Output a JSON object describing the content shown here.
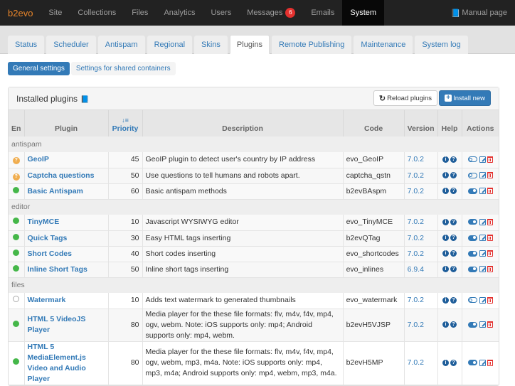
{
  "topnav": {
    "brand": "b2evo",
    "items": [
      {
        "label": "Site"
      },
      {
        "label": "Collections"
      },
      {
        "label": "Files"
      },
      {
        "label": "Analytics"
      },
      {
        "label": "Users"
      },
      {
        "label": "Messages",
        "badge": "6"
      },
      {
        "label": "Emails"
      },
      {
        "label": "System",
        "active": true
      }
    ],
    "manual_label": "Manual page",
    "manual_icon": "book-icon"
  },
  "tabs": [
    {
      "label": "Status"
    },
    {
      "label": "Scheduler"
    },
    {
      "label": "Antispam"
    },
    {
      "label": "Regional"
    },
    {
      "label": "Skins"
    },
    {
      "label": "Plugins",
      "active": true
    },
    {
      "label": "Remote Publishing"
    },
    {
      "label": "Maintenance"
    },
    {
      "label": "System log"
    }
  ],
  "subtabs": [
    {
      "label": "General settings",
      "active": true
    },
    {
      "label": "Settings for shared containers"
    }
  ],
  "panel": {
    "title": "Installed plugins",
    "title_icon": "book-icon",
    "reload_label": "Reload plugins",
    "install_label": "Install new"
  },
  "table": {
    "columns": {
      "en": "En",
      "plugin": "Plugin",
      "priority": "Priority",
      "description": "Description",
      "code": "Code",
      "version": "Version",
      "help": "Help",
      "actions": "Actions"
    },
    "groups": [
      {
        "name": "antispam",
        "rows": [
          {
            "status": "warn",
            "plugin": "GeoIP",
            "priority": "45",
            "description": "GeoIP plugin to detect user's country by IP address",
            "code": "evo_GeoIP",
            "version": "7.0.2",
            "enabled": false
          },
          {
            "status": "warn",
            "plugin": "Captcha questions",
            "priority": "50",
            "description": "Use questions to tell humans and robots apart.",
            "code": "captcha_qstn",
            "version": "7.0.2",
            "enabled": false
          },
          {
            "status": "on",
            "plugin": "Basic Antispam",
            "priority": "60",
            "description": "Basic antispam methods",
            "code": "b2evBAspm",
            "version": "7.0.2",
            "enabled": true
          }
        ]
      },
      {
        "name": "editor",
        "rows": [
          {
            "status": "on",
            "plugin": "TinyMCE",
            "priority": "10",
            "description": "Javascript WYSIWYG editor",
            "code": "evo_TinyMCE",
            "version": "7.0.2",
            "enabled": true
          },
          {
            "status": "on",
            "plugin": "Quick Tags",
            "priority": "30",
            "description": "Easy HTML tags inserting",
            "code": "b2evQTag",
            "version": "7.0.2",
            "enabled": true
          },
          {
            "status": "on",
            "plugin": "Short Codes",
            "priority": "40",
            "description": "Short codes inserting",
            "code": "evo_shortcodes",
            "version": "7.0.2",
            "enabled": true
          },
          {
            "status": "on",
            "plugin": "Inline Short Tags",
            "priority": "50",
            "description": "Inline short tags inserting",
            "code": "evo_inlines",
            "version": "6.9.4",
            "enabled": true
          }
        ]
      },
      {
        "name": "files",
        "rows": [
          {
            "status": "off",
            "plugin": "Watermark",
            "priority": "10",
            "description": "Adds text watermark to generated thumbnails",
            "code": "evo_watermark",
            "version": "7.0.2",
            "enabled": false
          },
          {
            "status": "on",
            "plugin": "HTML 5 VideoJS Player",
            "priority": "80",
            "description": "Media player for the these file formats: flv, m4v, f4v, mp4, ogv, webm. Note: iOS supports only: mp4; Android supports only: mp4, webm.",
            "code": "b2evH5VJSP",
            "version": "7.0.2",
            "enabled": true
          },
          {
            "status": "on",
            "plugin": "HTML 5 MediaElement.js Video and Audio Player",
            "priority": "80",
            "description": "Media player for the these file formats: flv, m4v, f4v, mp4, ogv, webm, mp3, m4a. Note: iOS supports only: mp4, mp3, m4a; Android supports only: mp4, webm, mp3, m4a.",
            "code": "b2evH5MP",
            "version": "7.0.2",
            "enabled": true
          }
        ]
      }
    ]
  },
  "colors": {
    "brand": "#e8852a",
    "link": "#337ab7",
    "enabled": "#45b749",
    "warning": "#f0ad4e",
    "danger": "#e4312f",
    "navbar": "#222222"
  }
}
